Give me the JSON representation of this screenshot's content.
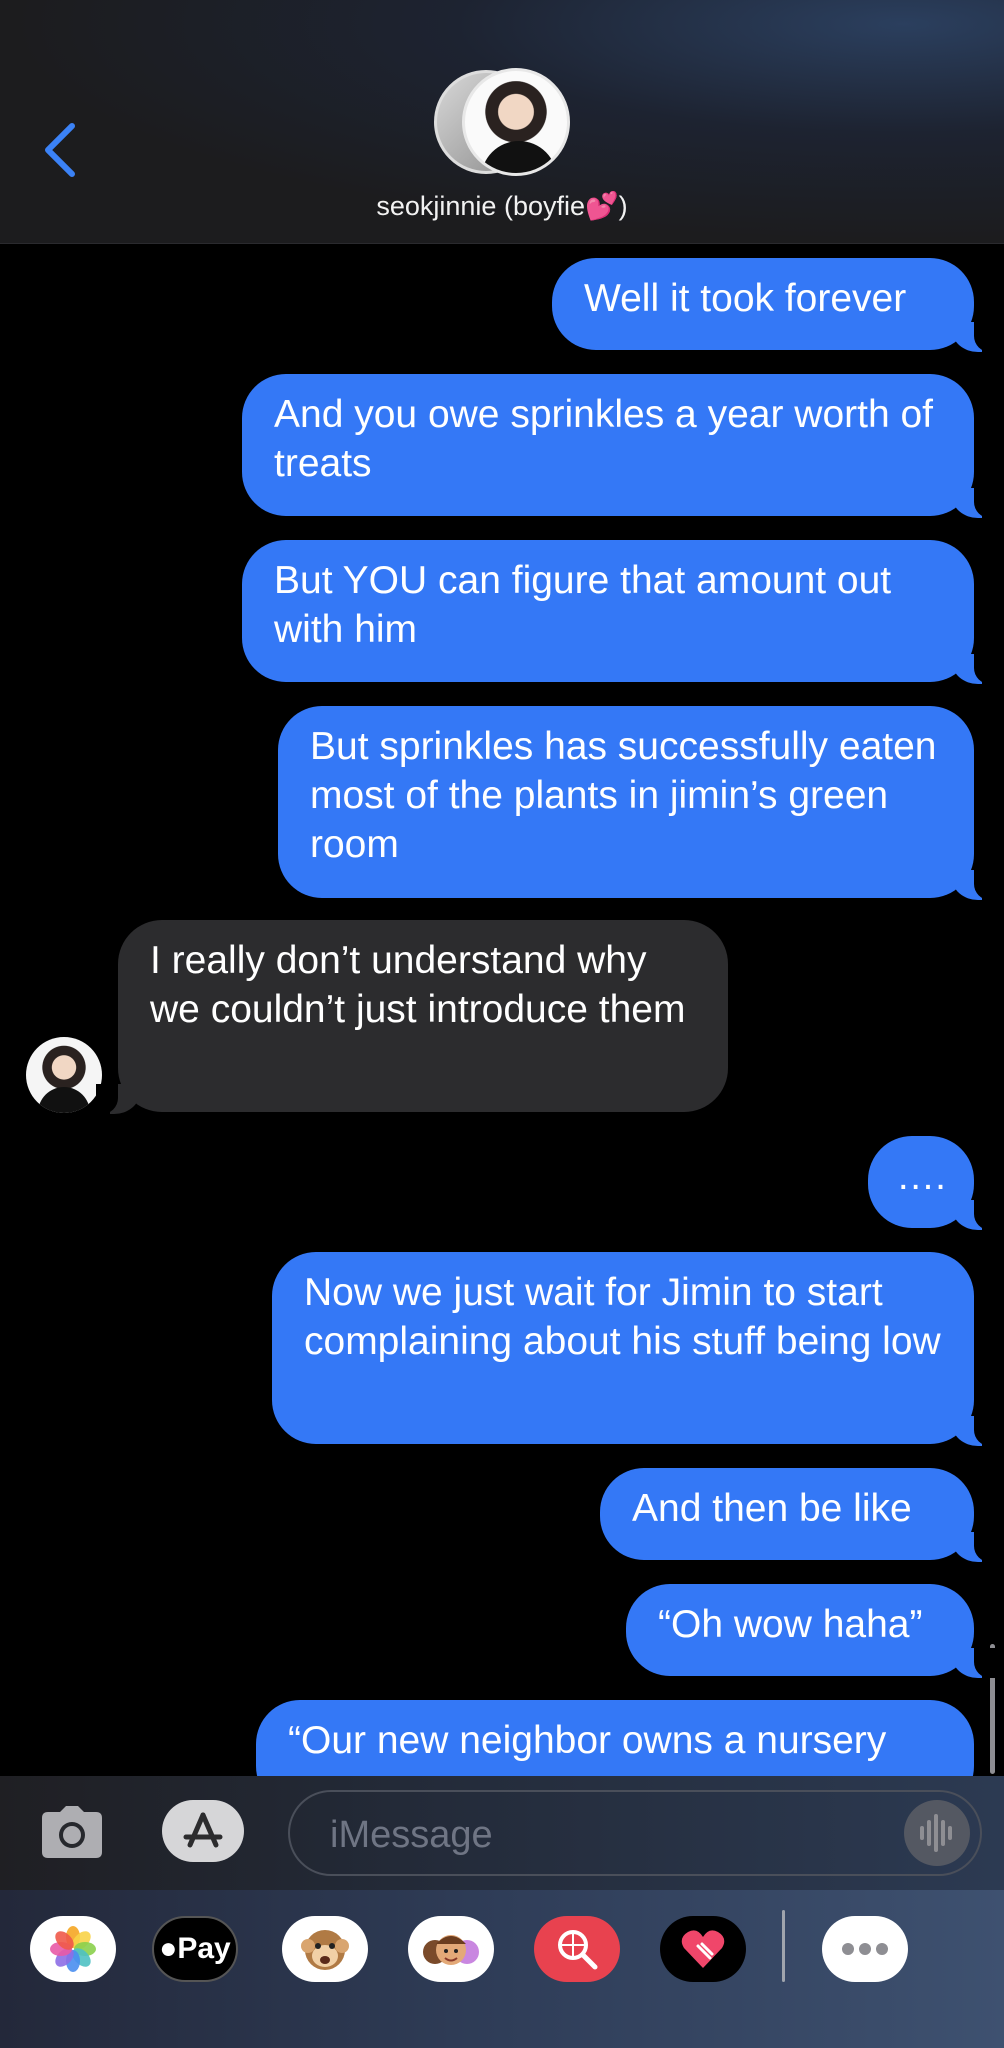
{
  "header": {
    "contact_name": "seokjinnie (boyfie💕)",
    "back_icon": "chevron-left-icon"
  },
  "messages": [
    {
      "direction": "out",
      "text": "Well it took forever"
    },
    {
      "direction": "out",
      "text": "And you owe sprinkles a year worth of treats"
    },
    {
      "direction": "out",
      "text": "But YOU can figure that amount out with him"
    },
    {
      "direction": "out",
      "text": "But sprinkles has successfully eaten most of the plants in jimin’s green room"
    },
    {
      "direction": "in",
      "text": "I really don’t understand why we couldn’t just introduce them"
    },
    {
      "direction": "out",
      "text": "…."
    },
    {
      "direction": "out",
      "text": "Now we just wait for Jimin to start complaining about his stuff being low"
    },
    {
      "direction": "out",
      "text": "And then be like"
    },
    {
      "direction": "out",
      "text": "“Oh wow haha”"
    },
    {
      "direction": "out",
      "text": "“Our new neighbor owns a nursery"
    }
  ],
  "input": {
    "placeholder": "iMessage",
    "camera_icon": "camera-icon",
    "apps_icon": "app-store-icon",
    "audio_icon": "waveform-icon"
  },
  "app_drawer": {
    "apps": [
      "Photos",
      "Apple Pay",
      "Animoji",
      "Memoji",
      "Images",
      "Digital Touch",
      "More"
    ],
    "apple_pay_label": "Pay"
  },
  "colors": {
    "outgoing_bubble": "#3478f6",
    "incoming_bubble": "#2c2c2e",
    "background": "#000000"
  }
}
